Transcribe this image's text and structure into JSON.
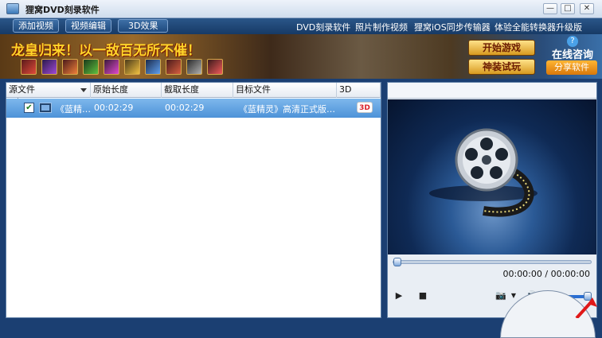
{
  "window": {
    "title": "狸窝DVD刻录软件",
    "controls": {
      "minimize": "—",
      "restore": "□",
      "close": "✕"
    }
  },
  "toolbar": {
    "add_video": "添加视频",
    "edit_video": "视频编辑",
    "effect_3d": "3D效果",
    "links": [
      "DVD刻录软件",
      "照片制作视频",
      "狸窝iOS同步传输器",
      "体验全能转换器升级版"
    ]
  },
  "banner": {
    "slogan": "龙皇归来！以一敌百无所不催！",
    "start_game": "开始游戏",
    "try_equipment": "神装试玩",
    "online_consult": "在线咨询",
    "share_software": "分享软件",
    "help_icon": "?"
  },
  "file_list": {
    "columns": [
      "源文件",
      "原始长度",
      "截取长度",
      "目标文件",
      "3D"
    ],
    "rows": [
      {
        "checked": true,
        "source": "《蓝精…",
        "original_length": "00:02:29",
        "clip_length": "00:02:29",
        "target": "《蓝精灵》高清正式版…",
        "badge_3d": "3D"
      }
    ]
  },
  "player": {
    "time": "00:00:00 / 00:00:00",
    "seek_progress": 0,
    "volume_level": 1.0
  },
  "colors": {
    "toolbar_bg": "#1f4a7e",
    "selected_row": "#4d92d8",
    "slogan": "#ffd62a",
    "accent_button": "#d79a1f"
  },
  "icons": {
    "app": "app-icon",
    "film": "film-icon",
    "play": "play-icon",
    "stop": "stop-icon",
    "snapshot": "camera-icon",
    "volume": "speaker-icon",
    "reel": "film-reel-icon"
  }
}
